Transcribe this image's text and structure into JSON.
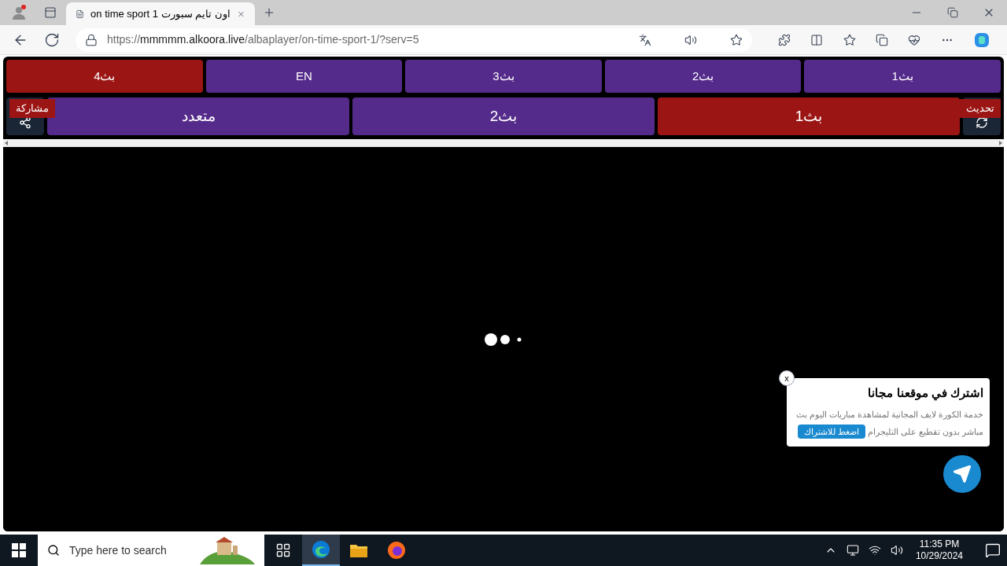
{
  "browser": {
    "tab_title": "on time sport 1 اون تايم سبورت",
    "url_scheme": "https://",
    "url_host": "mmmmm.alkoora.live",
    "url_path": "/albaplayer/on-time-sport-1/?serv=5"
  },
  "servers": [
    {
      "label": "بث1",
      "selected": false
    },
    {
      "label": "بث2",
      "selected": false
    },
    {
      "label": "بث3",
      "selected": false
    },
    {
      "label": "EN",
      "selected": false
    },
    {
      "label": "بث4",
      "selected": true
    }
  ],
  "streams": [
    {
      "label": "بث1",
      "selected": true
    },
    {
      "label": "بث2",
      "selected": false
    },
    {
      "label": "متعدد",
      "selected": false
    }
  ],
  "share_label": "مشاركة",
  "refresh_label": "تحديث",
  "popup": {
    "close": "x",
    "title": "اشترك في موقعنا مجانا",
    "text": "خدمة الكورة لايف المجانية لمشاهدة مباريات اليوم بث مباشر بدون تقطيع على التليجرام",
    "button": "اضغط للاشتراك"
  },
  "taskbar": {
    "search_placeholder": "Type here to search",
    "apps": [
      {
        "kind": "taskview",
        "selected": false
      },
      {
        "kind": "edge",
        "selected": true
      },
      {
        "kind": "explorer",
        "selected": false
      },
      {
        "kind": "firefox",
        "selected": false
      }
    ],
    "time": "11:35 PM",
    "date": "10/29/2024"
  }
}
